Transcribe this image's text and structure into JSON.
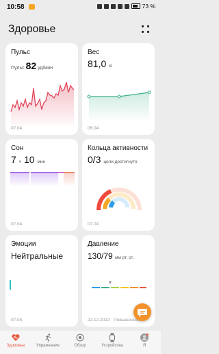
{
  "status": {
    "time": "10:58",
    "battery": "73 %"
  },
  "header": {
    "title": "Здоровье"
  },
  "pulse": {
    "title": "Пульс",
    "prefix": "Пульс",
    "value": "82",
    "unit": "уд/мин",
    "date": "07.04"
  },
  "weight": {
    "title": "Вес",
    "value": "81,0",
    "unit": "кг",
    "date": "06.04"
  },
  "sleep": {
    "title": "Сон",
    "hours": "7",
    "h_unit": "ч",
    "minutes": "10",
    "m_unit": "мин",
    "date": "07.04"
  },
  "rings": {
    "title": "Кольца активности",
    "value": "0/3",
    "caption": "цели достигнуто",
    "date": "07.04"
  },
  "emotions": {
    "title": "Эмоции",
    "value": "Нейтральные",
    "date": "07.04"
  },
  "pressure": {
    "title": "Давление",
    "value": "130/79",
    "unit": "мм рт. ст.",
    "date": "22.12.2022",
    "status": "Повышенное"
  },
  "nav": [
    {
      "label": "Здоровье"
    },
    {
      "label": "Упражнение"
    },
    {
      "label": "Обзор"
    },
    {
      "label": "Устройства"
    },
    {
      "label": "Я"
    }
  ],
  "colors": {
    "accent": "#e8573f",
    "pulse": "#e0455a",
    "weight": "#3cb08a",
    "sleep": "#a66ee8",
    "emotion": "#2cc2c6",
    "fab": "#f2922b"
  },
  "icons": [
    "heart-icon",
    "running-icon",
    "overview-icon",
    "watch-icon",
    "profile-icon",
    "grid-icon",
    "chat-icon"
  ]
}
